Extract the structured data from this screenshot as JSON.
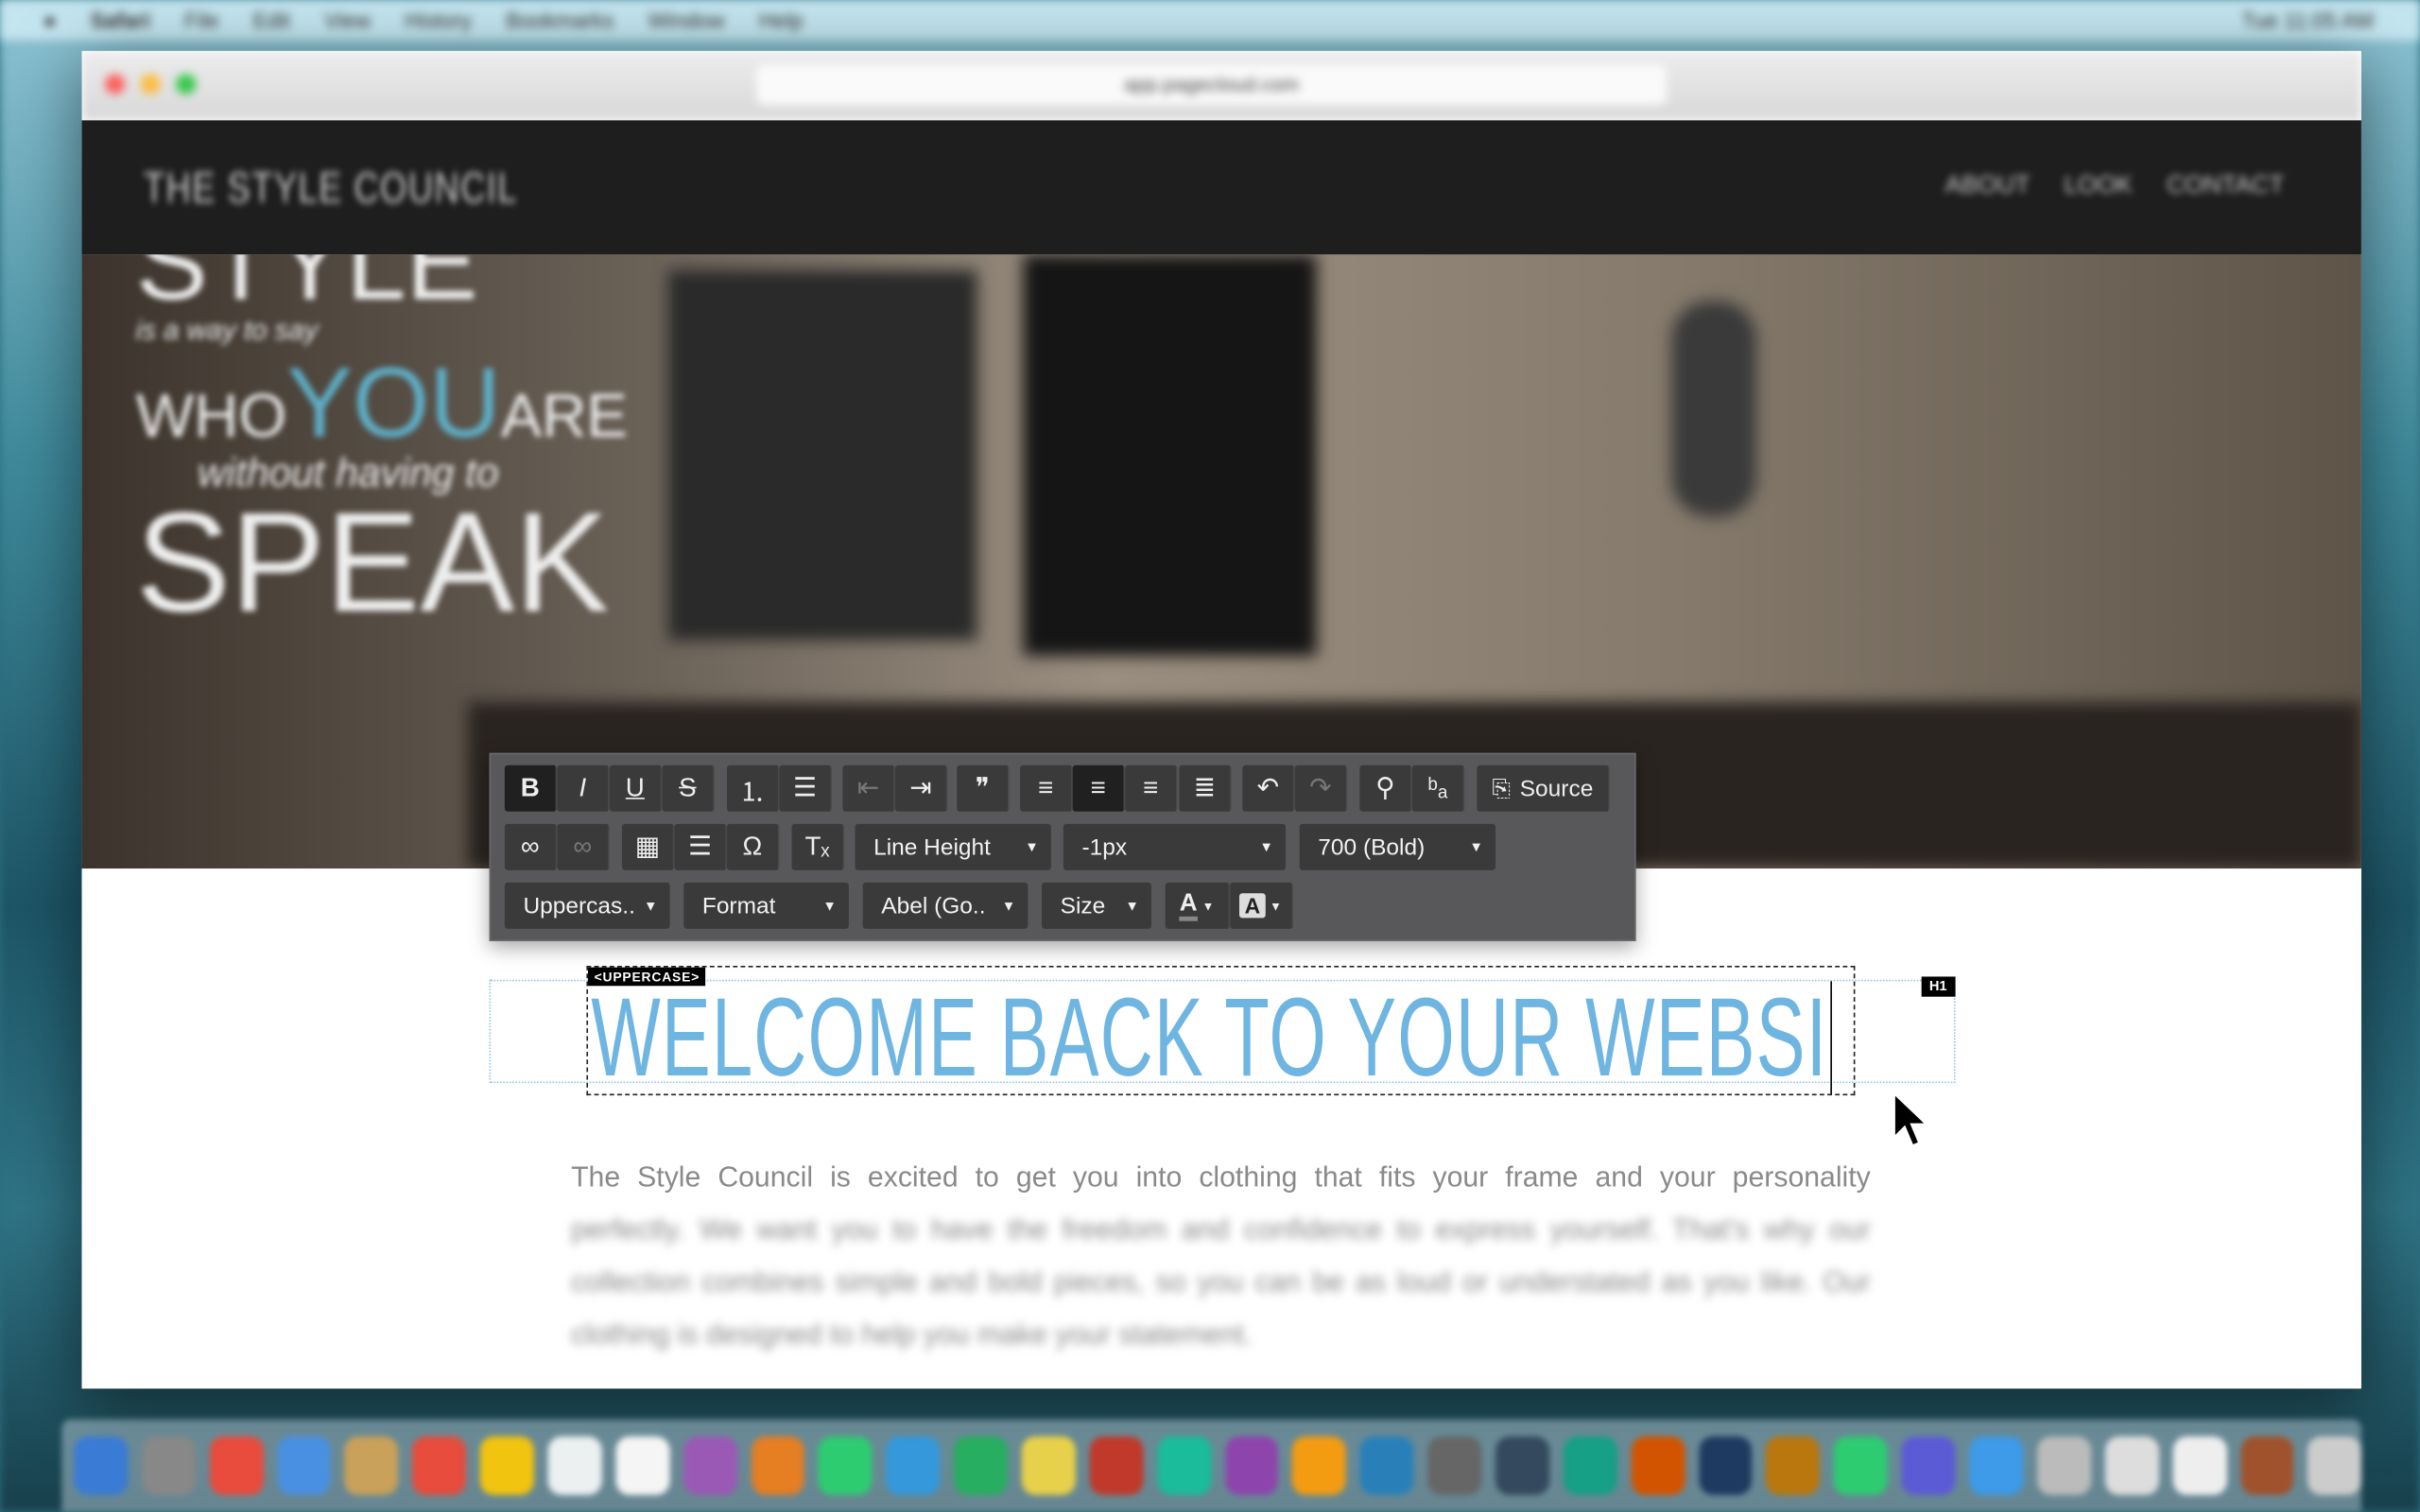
{
  "menubar": {
    "app": "Safari",
    "items": [
      "File",
      "Edit",
      "View",
      "History",
      "Bookmarks",
      "Window",
      "Help"
    ],
    "clock": "Tue 11:05 AM"
  },
  "browser": {
    "url": "app.pagecloud.com"
  },
  "site": {
    "logo": "THE STYLE COUNCIL",
    "nav": [
      "ABOUT",
      "LOOK",
      "CONTACT"
    ],
    "hero": {
      "line1": "STYLE",
      "line2": "is a way to say",
      "line3a": "WHO",
      "line3b": "YOU",
      "line3c": "ARE",
      "line4": "without having to",
      "line5": "SPEAK"
    }
  },
  "toolbar": {
    "row1": [
      {
        "icon": "bold-icon",
        "glyph": "B",
        "active": true
      },
      {
        "icon": "italic-icon",
        "glyph": "I"
      },
      {
        "icon": "underline-icon",
        "glyph": "U"
      },
      {
        "icon": "strikethrough-icon",
        "glyph": "S"
      },
      {
        "icon": "numbered-list-icon",
        "glyph": "⒈"
      },
      {
        "icon": "bulleted-list-icon",
        "glyph": "☰"
      },
      {
        "icon": "outdent-icon",
        "glyph": "⇤",
        "disabled": true
      },
      {
        "icon": "indent-icon",
        "glyph": "⇥"
      },
      {
        "icon": "blockquote-icon",
        "glyph": "❞"
      },
      {
        "icon": "align-left-icon",
        "glyph": "≡"
      },
      {
        "icon": "align-center-icon",
        "glyph": "≡",
        "active": true
      },
      {
        "icon": "align-right-icon",
        "glyph": "≡"
      },
      {
        "icon": "align-justify-icon",
        "glyph": "≣"
      },
      {
        "icon": "undo-icon",
        "glyph": "↶"
      },
      {
        "icon": "redo-icon",
        "glyph": "↷",
        "disabled": true
      },
      {
        "icon": "find-icon",
        "glyph": "⚲"
      },
      {
        "icon": "replace-icon",
        "glyph": "ᵇₐ"
      }
    ],
    "source_label": "Source",
    "row2": [
      {
        "icon": "link-icon",
        "glyph": "∞"
      },
      {
        "icon": "unlink-icon",
        "glyph": "∞",
        "disabled": true
      },
      {
        "icon": "table-icon",
        "glyph": "▦"
      },
      {
        "icon": "horizontal-rule-icon",
        "glyph": "☰"
      },
      {
        "icon": "special-char-icon",
        "glyph": "Ω"
      },
      {
        "icon": "remove-format-icon",
        "glyph": "Tₓ"
      }
    ],
    "line_height": "Line Height",
    "letter_spacing": "-1px",
    "font_weight": "700 (Bold)",
    "text_transform": "Uppercas..",
    "format": "Format",
    "font": "Abel (Go..",
    "size": "Size",
    "text_color_glyph": "A",
    "bg_color_glyph": "A"
  },
  "editor": {
    "uppercase_tag": "<UPPERCASE>",
    "element_tag": "H1",
    "heading": "WELCOME BACK TO YOUR WEBSI",
    "heading_color": "#6fb5e2",
    "paragraph_line1": "The Style Council is excited to get you into clothing that fits your frame and your personality",
    "paragraph_rest": "perfectly. We want you to have the freedom and confidence to express yourself. That's why our collection combines simple and bold pieces, so you can be as loud or understated as you like. Our clothing is designed to help you make your statement."
  }
}
